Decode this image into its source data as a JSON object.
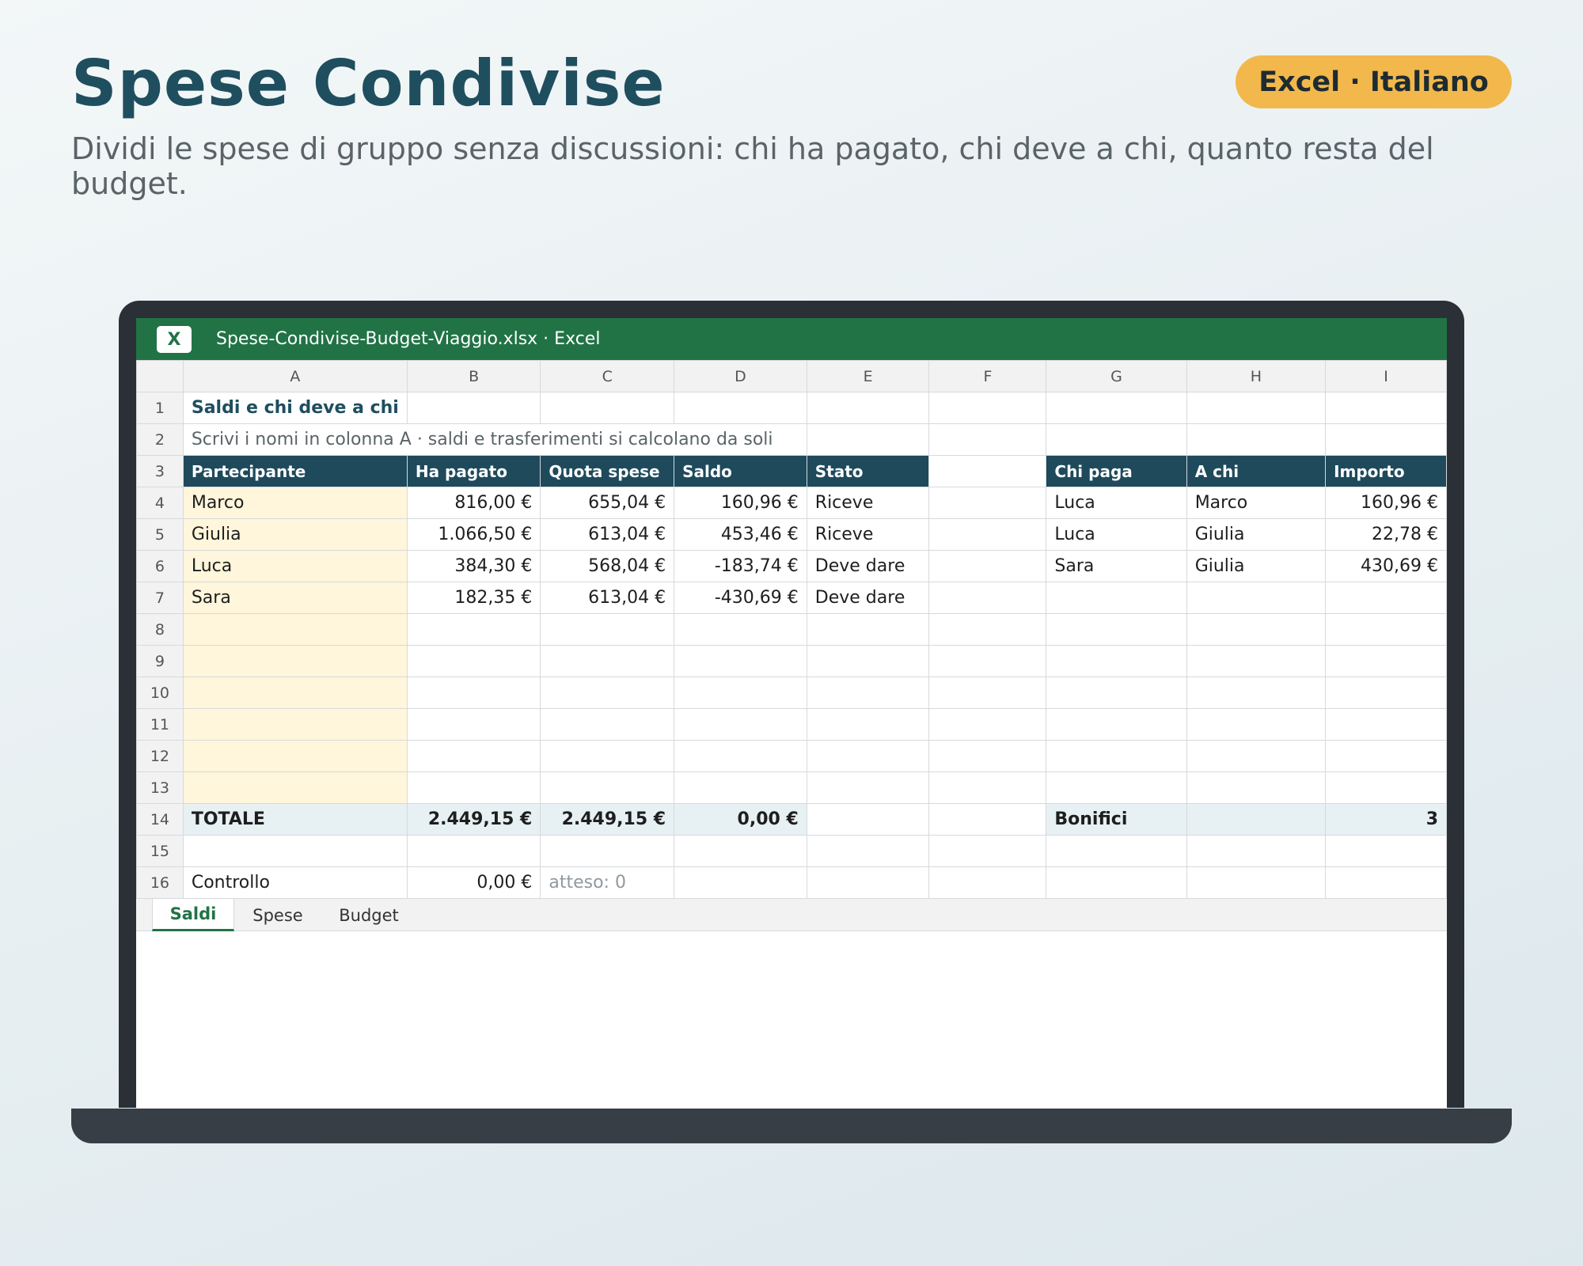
{
  "header": {
    "title": "Spese Condivise",
    "subtitle": "Dividi le spese di gruppo senza discussioni: chi ha pagato, chi deve a chi, quanto resta del budget.",
    "badge": "Excel · Italiano"
  },
  "window": {
    "app_icon_letter": "X",
    "title": "Spese-Condivise-Budget-Viaggio.xlsx · Excel"
  },
  "columns": [
    "A",
    "B",
    "C",
    "D",
    "E",
    "F",
    "G",
    "H",
    "I"
  ],
  "rows": [
    "1",
    "2",
    "3",
    "4",
    "5",
    "6",
    "7",
    "8",
    "9",
    "10",
    "11",
    "12",
    "13",
    "14",
    "15",
    "16"
  ],
  "sheet": {
    "title": "Saldi e chi deve a chi",
    "hint": "Scrivi i nomi in colonna A · saldi e trasferimenti si calcolano da soli",
    "balances_headers": [
      "Partecipante",
      "Ha pagato",
      "Quota spese",
      "Saldo",
      "Stato"
    ],
    "balances": [
      {
        "name": "Marco",
        "paid": "816,00 €",
        "share": "655,04 €",
        "balance": "160,96 €",
        "status": "Riceve"
      },
      {
        "name": "Giulia",
        "paid": "1.066,50 €",
        "share": "613,04 €",
        "balance": "453,46 €",
        "status": "Riceve"
      },
      {
        "name": "Luca",
        "paid": "384,30 €",
        "share": "568,04 €",
        "balance": "-183,74 €",
        "status": "Deve dare"
      },
      {
        "name": "Sara",
        "paid": "182,35 €",
        "share": "613,04 €",
        "balance": "-430,69 €",
        "status": "Deve dare"
      }
    ],
    "transfers_headers": [
      "Chi paga",
      "A chi",
      "Importo"
    ],
    "transfers": [
      {
        "from": "Luca",
        "to": "Marco",
        "amount": "160,96 €"
      },
      {
        "from": "Luca",
        "to": "Giulia",
        "amount": "22,78 €"
      },
      {
        "from": "Sara",
        "to": "Giulia",
        "amount": "430,69 €"
      }
    ],
    "totals": {
      "label": "TOTALE",
      "paid": "2.449,15 €",
      "share": "2.449,15 €",
      "balance": "0,00 €",
      "transfers_label": "Bonifici",
      "transfers_count": "3"
    },
    "check": {
      "label": "Controllo",
      "value": "0,00 €",
      "expected": "atteso: 0"
    }
  },
  "tabs": [
    {
      "label": "Saldi",
      "active": true
    },
    {
      "label": "Spese",
      "active": false
    },
    {
      "label": "Budget",
      "active": false
    }
  ],
  "colors": {
    "excel_green": "#217346",
    "header_teal": "#1e4a5c",
    "title_color": "#1f4e5f",
    "badge_bg": "#f2b84b",
    "input_fill": "#fff6dc",
    "total_fill": "#e7f0f3"
  }
}
